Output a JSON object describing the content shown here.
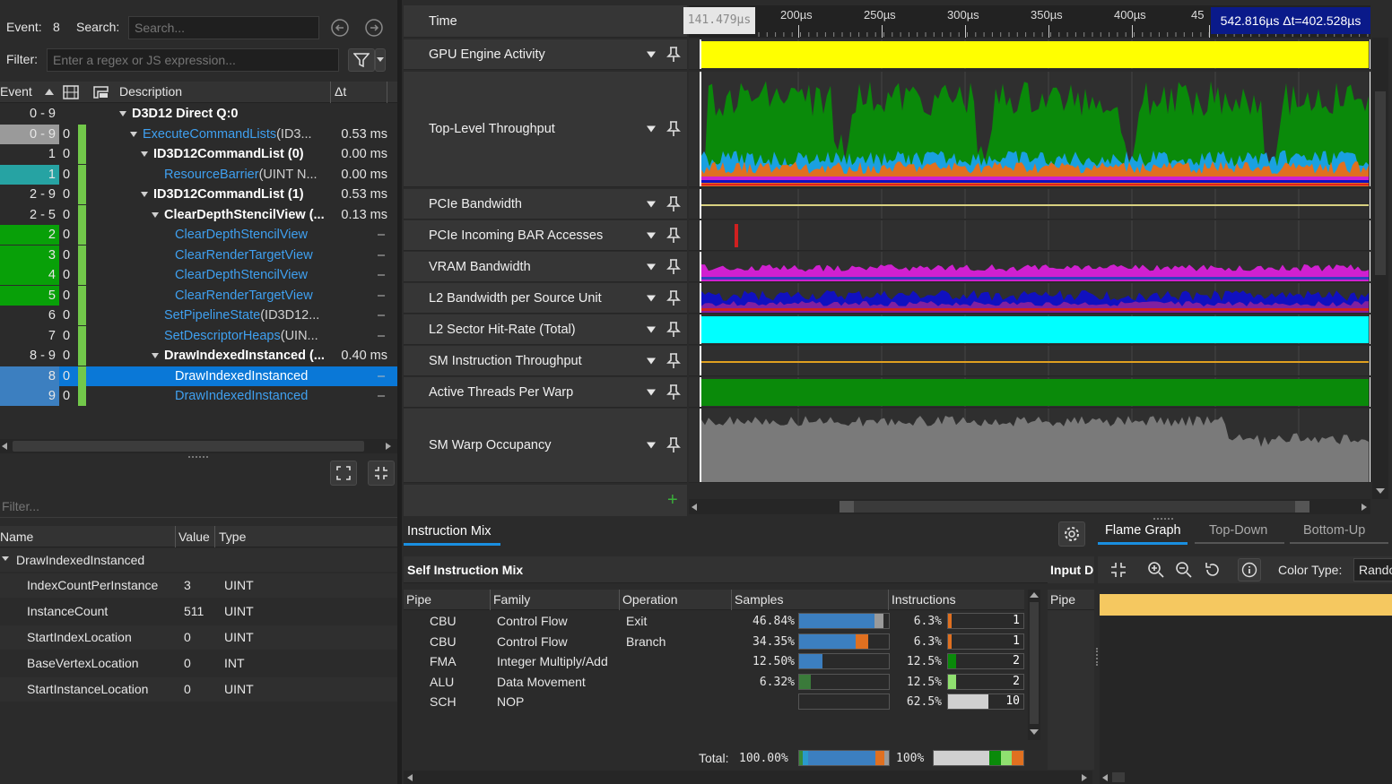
{
  "toolbar": {
    "event_label": "Event:",
    "event_value": "8",
    "search_label": "Search:",
    "search_placeholder": "Search...",
    "filter_label": "Filter:",
    "filter_placeholder": "Enter a regex or JS expression..."
  },
  "event_tree": {
    "columns": [
      "Event",
      "Description",
      "Δt"
    ],
    "rows": [
      {
        "event": "0 - 9",
        "zero": "",
        "desc": "D3D12 Direct Q:0",
        "dt": "",
        "style": "bold",
        "indent": 0,
        "expand": true,
        "bg": "none",
        "gbar": false
      },
      {
        "event": "0 - 9",
        "zero": "0",
        "desc": "ExecuteCommandLists",
        "desc_suffix": "(ID3...",
        "dt": "0.53 ms",
        "style": "link",
        "indent": 1,
        "expand": true,
        "bg": "#9a9a9a",
        "gbar": true
      },
      {
        "event": "1",
        "zero": "0",
        "desc": "ID3D12CommandList (0)",
        "desc_suffix": "",
        "dt": "0.00 ms",
        "style": "bold",
        "indent": 2,
        "expand": true,
        "bg": "none",
        "gbar": true
      },
      {
        "event": "1",
        "zero": "0",
        "desc": "ResourceBarrier",
        "desc_suffix": "(UINT N...",
        "dt": "0.00 ms",
        "style": "link",
        "indent": 3,
        "expand": false,
        "bg": "#26a3a3",
        "gbar": true
      },
      {
        "event": "2 - 9",
        "zero": "0",
        "desc": "ID3D12CommandList (1)",
        "desc_suffix": "",
        "dt": "0.53 ms",
        "style": "bold",
        "indent": 2,
        "expand": true,
        "bg": "none",
        "gbar": true
      },
      {
        "event": "2 - 5",
        "zero": "0",
        "desc": "ClearDepthStencilView (...",
        "desc_suffix": "",
        "dt": "0.13 ms",
        "style": "bold",
        "indent": 3,
        "expand": true,
        "bg": "none",
        "gbar": true
      },
      {
        "event": "2",
        "zero": "0",
        "desc": "ClearDepthStencilView",
        "desc_suffix": "",
        "dt": "–",
        "style": "link",
        "indent": 4,
        "expand": false,
        "bg": "#08a008",
        "gbar": true
      },
      {
        "event": "3",
        "zero": "0",
        "desc": "ClearRenderTargetView",
        "desc_suffix": "",
        "dt": "–",
        "style": "link",
        "indent": 4,
        "expand": false,
        "bg": "#08a008",
        "gbar": true
      },
      {
        "event": "4",
        "zero": "0",
        "desc": "ClearDepthStencilView",
        "desc_suffix": "",
        "dt": "–",
        "style": "link",
        "indent": 4,
        "expand": false,
        "bg": "#08a008",
        "gbar": true
      },
      {
        "event": "5",
        "zero": "0",
        "desc": "ClearRenderTargetView",
        "desc_suffix": "",
        "dt": "–",
        "style": "link",
        "indent": 4,
        "expand": false,
        "bg": "#08a008",
        "gbar": true
      },
      {
        "event": "6",
        "zero": "0",
        "desc": "SetPipelineState",
        "desc_suffix": "(ID3D12...",
        "dt": "–",
        "style": "link",
        "indent": 3,
        "expand": false,
        "bg": "none",
        "gbar": true
      },
      {
        "event": "7",
        "zero": "0",
        "desc": "SetDescriptorHeaps",
        "desc_suffix": "(UIN...",
        "dt": "–",
        "style": "link",
        "indent": 3,
        "expand": false,
        "bg": "none",
        "gbar": true
      },
      {
        "event": "8 - 9",
        "zero": "0",
        "desc": "DrawIndexedInstanced (...",
        "desc_suffix": "",
        "dt": "0.40 ms",
        "style": "bold",
        "indent": 3,
        "expand": true,
        "bg": "none",
        "gbar": true
      },
      {
        "event": "8",
        "zero": "0",
        "desc": "DrawIndexedInstanced",
        "desc_suffix": "",
        "dt": "–",
        "style": "link",
        "indent": 4,
        "expand": false,
        "bg": "#3c7fc0",
        "gbar": true,
        "selected": true
      },
      {
        "event": "9",
        "zero": "0",
        "desc": "DrawIndexedInstanced",
        "desc_suffix": "",
        "dt": "–",
        "style": "link",
        "indent": 4,
        "expand": false,
        "bg": "#3c7fc0",
        "gbar": true
      }
    ]
  },
  "params": {
    "filter_placeholder": "Filter...",
    "columns": [
      "Name",
      "Value",
      "Type"
    ],
    "group": "DrawIndexedInstanced",
    "rows": [
      {
        "name": "IndexCountPerInstance",
        "value": "3",
        "type": "UINT"
      },
      {
        "name": "InstanceCount",
        "value": "511",
        "type": "UINT"
      },
      {
        "name": "StartIndexLocation",
        "value": "0",
        "type": "UINT"
      },
      {
        "name": "BaseVertexLocation",
        "value": "0",
        "type": "INT"
      },
      {
        "name": "StartInstanceLocation",
        "value": "0",
        "type": "UINT"
      }
    ]
  },
  "timeline": {
    "time_label": "Time",
    "cursor_left": "141.479µs",
    "cursor_right": "542.816µs Δt=402.528µs",
    "ticks": [
      "200µs",
      "250µs",
      "300µs",
      "350µs",
      "400µs",
      "45"
    ],
    "tracks": [
      {
        "name": "GPU Engine Activity",
        "kind": "solid",
        "color": "#ffff00"
      },
      {
        "name": "Top-Level Throughput",
        "kind": "throughput"
      },
      {
        "name": "PCIe Bandwidth",
        "kind": "line",
        "color": "#d8d080"
      },
      {
        "name": "PCIe Incoming BAR Accesses",
        "kind": "spike",
        "color": "#d02020"
      },
      {
        "name": "VRAM Bandwidth",
        "kind": "vram"
      },
      {
        "name": "L2 Bandwidth per Source Unit",
        "kind": "l2"
      },
      {
        "name": "L2 Sector Hit-Rate (Total)",
        "kind": "solid",
        "color": "#00ffff"
      },
      {
        "name": "SM Instruction Throughput",
        "kind": "line",
        "color": "#e0a020"
      },
      {
        "name": "Active Threads Per Warp",
        "kind": "solid",
        "color": "#0a8a0a"
      },
      {
        "name": "SM Warp Occupancy",
        "kind": "occupancy",
        "color": "#7a7a7a"
      }
    ],
    "colors": {
      "green": "#0a8a0a",
      "cyan": "#1aa0e0",
      "orange": "#e07020",
      "magenta": "#d020d0",
      "blue": "#1010c0"
    }
  },
  "instruction_mix": {
    "tab": "Instruction Mix",
    "title": "Self Instruction Mix",
    "columns": [
      "Pipe",
      "Family",
      "Operation",
      "Samples",
      "Instructions"
    ],
    "rows": [
      {
        "pipe": "CBU",
        "family": "Control Flow",
        "operation": "Exit",
        "samples": "46.84%",
        "samples_frac": 0.96,
        "instructions_pct": "6.3%",
        "instructions_count": "1",
        "bar_color": "#e07020"
      },
      {
        "pipe": "CBU",
        "family": "Control Flow",
        "operation": "Branch",
        "samples": "34.35%",
        "samples_frac": 0.72,
        "instructions_pct": "6.3%",
        "instructions_count": "1",
        "bar_color": "#e07020"
      },
      {
        "pipe": "FMA",
        "family": "Integer Multiply/Add",
        "operation": "",
        "samples": "12.50%",
        "samples_frac": 0.26,
        "instructions_pct": "12.5%",
        "instructions_count": "2",
        "bar_color": "#0a8a0a"
      },
      {
        "pipe": "ALU",
        "family": "Data Movement",
        "operation": "",
        "samples": "6.32%",
        "samples_frac": 0.13,
        "instructions_pct": "12.5%",
        "instructions_count": "2",
        "bar_color": "#90e070"
      },
      {
        "pipe": "SCH",
        "family": "NOP",
        "operation": "",
        "samples": "",
        "samples_frac": 0,
        "instructions_pct": "62.5%",
        "instructions_count": "10",
        "bar_color": "#d0d0d0"
      }
    ],
    "total_label": "Total:",
    "total_samples": "100.00%",
    "total_instructions": "100%"
  },
  "flame": {
    "tabs": [
      "Flame Graph",
      "Top-Down",
      "Bottom-Up"
    ],
    "input_label": "Input D",
    "pipe_label": "Pipe",
    "color_type_label": "Color Type:",
    "color_type_value": "Rando"
  }
}
